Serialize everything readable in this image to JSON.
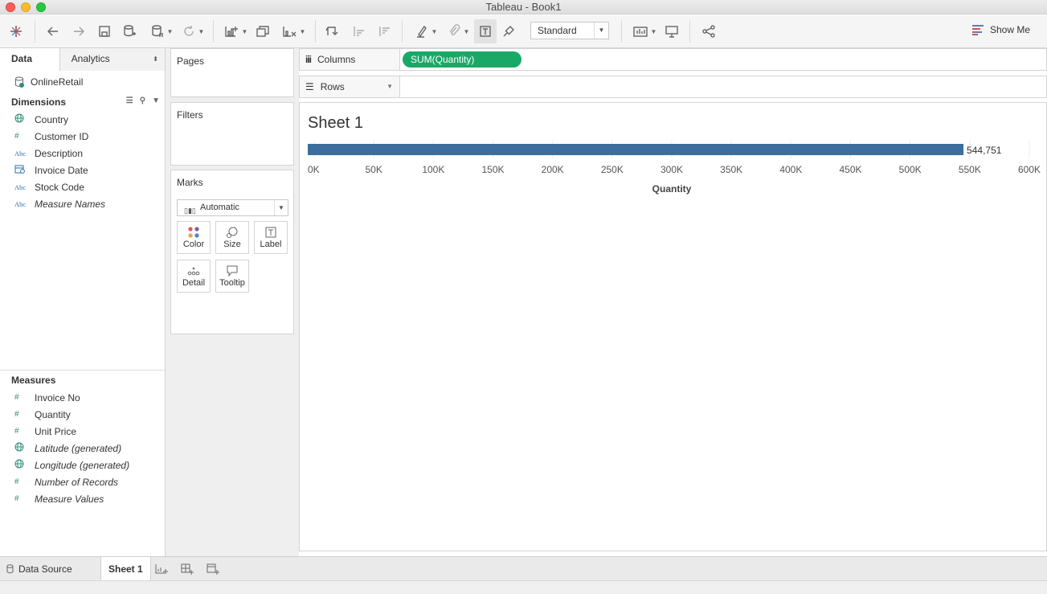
{
  "window": {
    "title": "Tableau - Book1"
  },
  "toolbar": {
    "icons": [
      "tableau-logo-icon",
      "undo-icon",
      "redo-icon",
      "save-icon",
      "new-datasource-icon",
      "pause-updates-icon",
      "refresh-icon",
      "new-worksheet-icon",
      "duplicate-sheet-icon",
      "clear-sheet-icon",
      "swap-icon",
      "sort-ascending-icon",
      "sort-descending-icon",
      "highlight-icon",
      "group-icon",
      "show-mark-labels-icon",
      "pin-icon",
      "chart-type-icon",
      "presentation-icon",
      "share-icon"
    ],
    "fit": "Standard",
    "show_me": "Show Me"
  },
  "left_panel": {
    "tabs": {
      "data": "Data",
      "analytics": "Analytics"
    },
    "datasource": "OnlineRetail",
    "dimensions_title": "Dimensions",
    "dimensions": [
      {
        "label": "Country",
        "icon": "globe-icon",
        "italic": false
      },
      {
        "label": "Customer ID",
        "icon": "number-icon",
        "italic": false
      },
      {
        "label": "Description",
        "icon": "abc-icon",
        "italic": false
      },
      {
        "label": "Invoice Date",
        "icon": "calendar-icon",
        "italic": false
      },
      {
        "label": "Stock Code",
        "icon": "abc-icon",
        "italic": false
      },
      {
        "label": "Measure Names",
        "icon": "abc-icon",
        "italic": true
      }
    ],
    "measures_title": "Measures",
    "measures": [
      {
        "label": "Invoice No",
        "icon": "number-icon",
        "italic": false
      },
      {
        "label": "Quantity",
        "icon": "number-icon",
        "italic": false
      },
      {
        "label": "Unit Price",
        "icon": "number-icon",
        "italic": false
      },
      {
        "label": "Latitude (generated)",
        "icon": "globe-icon",
        "italic": true
      },
      {
        "label": "Longitude (generated)",
        "icon": "globe-icon",
        "italic": true
      },
      {
        "label": "Number of Records",
        "icon": "number-icon",
        "italic": true
      },
      {
        "label": "Measure Values",
        "icon": "number-icon",
        "italic": true
      }
    ]
  },
  "cards": {
    "pages": "Pages",
    "filters": "Filters",
    "marks": "Marks",
    "mark_type": "Automatic",
    "buttons": {
      "color": "Color",
      "size": "Size",
      "label": "Label",
      "detail": "Detail",
      "tooltip": "Tooltip"
    }
  },
  "shelves": {
    "columns_label": "Columns",
    "columns_pill": "SUM(Quantity)",
    "rows_label": "Rows"
  },
  "view": {
    "sheet_title": "Sheet 1"
  },
  "chart_data": {
    "type": "bar",
    "orientation": "horizontal",
    "categories": [
      ""
    ],
    "values": [
      544751
    ],
    "data_labels": [
      "544,751"
    ],
    "xlabel": "Quantity",
    "ylabel": "",
    "xlim": [
      0,
      600000
    ],
    "ticks": [
      0,
      50000,
      100000,
      150000,
      200000,
      250000,
      300000,
      350000,
      400000,
      450000,
      500000,
      550000,
      600000
    ],
    "tick_labels": [
      "0K",
      "50K",
      "100K",
      "150K",
      "200K",
      "250K",
      "300K",
      "350K",
      "400K",
      "450K",
      "500K",
      "550K",
      "600K"
    ],
    "colors": {
      "bar": "#3b6e9e"
    },
    "grid": true
  },
  "bottom_tabs": {
    "datasource": "Data Source",
    "sheet": "Sheet 1"
  },
  "colors": {
    "pill": "#1aa866",
    "bar": "#3b6e9e"
  }
}
